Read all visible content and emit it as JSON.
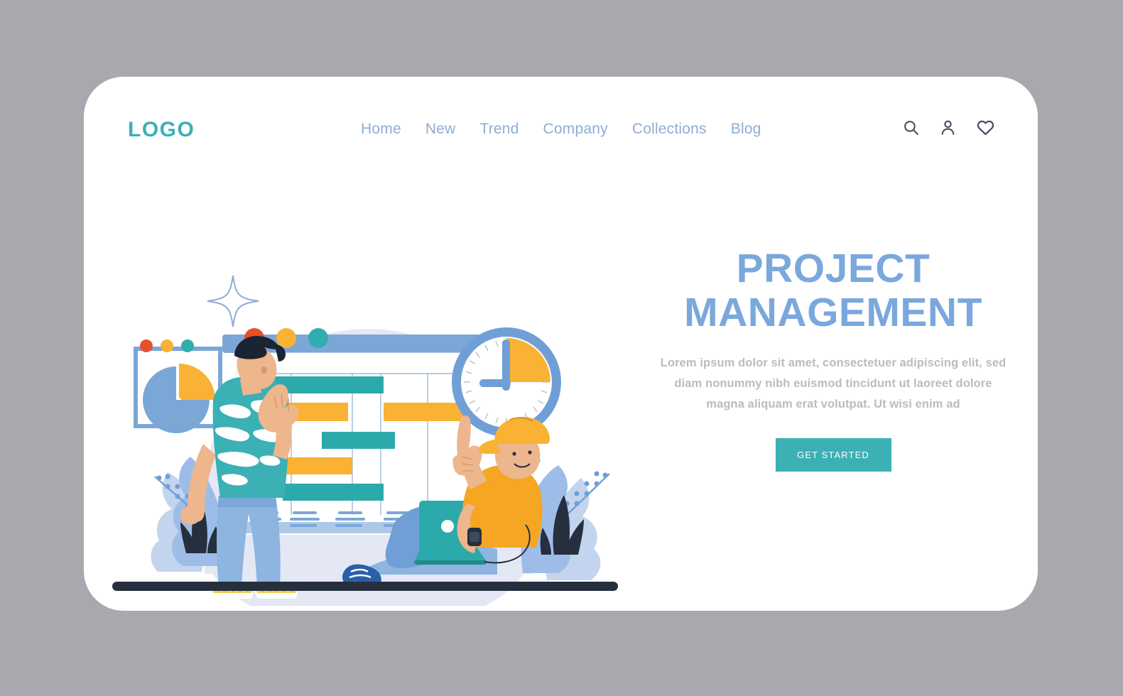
{
  "page": {
    "background_color": "#a9a8ae",
    "card_background": "#ffffff"
  },
  "header": {
    "logo": "LOGO",
    "logo_color": "#3bb0b5",
    "nav": [
      {
        "label": "Home"
      },
      {
        "label": "New"
      },
      {
        "label": "Trend"
      },
      {
        "label": "Company"
      },
      {
        "label": "Collections"
      },
      {
        "label": "Blog"
      }
    ],
    "nav_color": "#8eadd4",
    "actions": [
      {
        "icon": "search-icon"
      },
      {
        "icon": "user-icon"
      },
      {
        "icon": "heart-icon"
      }
    ],
    "action_color": "#454f63"
  },
  "hero": {
    "title_line_1": "PROJECT",
    "title_line_2": "MANAGEMENT",
    "title_color": "#7aa8dd",
    "paragraph": "Lorem ipsum dolor sit amet, consectetuer adipiscing elit, sed diam nonummy nibh euismod tincidunt ut laoreet dolore magna aliquam erat volutpat. Ut wisi enim ad",
    "paragraph_color": "#b9bcc2",
    "cta_label": "GET STARTED",
    "cta_background": "#3bb0b5",
    "cta_text_color": "#ffffff"
  },
  "illustration": {
    "name": "project-management-scene",
    "backdrop_circle_color": "#e4e8f5",
    "ground_line_color": "#262f3d",
    "window": {
      "title_bar_color": "#7ba7d7",
      "body_color": "#ffffff",
      "dots": [
        {
          "name": "dot-red",
          "color": "#e8502a"
        },
        {
          "name": "dot-yellow",
          "color": "#f9b233"
        },
        {
          "name": "dot-teal",
          "color": "#30adaf"
        }
      ]
    },
    "gantt": {
      "axis_color": "#8eadd4",
      "bar_colors": {
        "teal": "#2ca9ab",
        "orange": "#f9b233"
      },
      "bars": [
        {
          "label": "task-1",
          "color": "teal",
          "start": 0,
          "length": 0.6
        },
        {
          "label": "task-2",
          "color": "orange",
          "start": 0,
          "length": 0.42
        },
        {
          "label": "task-3",
          "color": "orange",
          "start": 0.62,
          "length": 0.33
        },
        {
          "label": "task-4",
          "color": "teal",
          "start": 0.31,
          "length": 0.33
        },
        {
          "label": "task-5",
          "color": "orange",
          "start": 0.11,
          "length": 0.31
        },
        {
          "label": "task-6",
          "color": "teal",
          "start": 0.11,
          "length": 0.5
        }
      ],
      "legend_groups": 5,
      "legend_line_color": "#7ba7d7"
    },
    "pie_panel": {
      "frame_color": "#7ba7d7",
      "slices": [
        {
          "name": "slice-blue",
          "color": "#7ba7d7",
          "percent": 72
        },
        {
          "name": "slice-orange",
          "color": "#f9b233",
          "percent": 28
        }
      ],
      "dots": [
        {
          "name": "dot-red",
          "color": "#e8502a"
        },
        {
          "name": "dot-yellow",
          "color": "#f9b233"
        },
        {
          "name": "dot-teal",
          "color": "#30adaf"
        }
      ]
    },
    "clock": {
      "ring_color": "#6f9fd6",
      "face_color": "#ffffff",
      "segment_color": "#f9b233",
      "hand_color": "#6f9fd6",
      "tick_color": "#bfc6d4"
    },
    "sparkles": [
      {
        "name": "sparkle-top",
        "color": "#8eadd4"
      },
      {
        "name": "sparkle-left",
        "color": "#8eadd4"
      },
      {
        "name": "sparkle-right",
        "color": "#8eadd4"
      }
    ],
    "plants": {
      "leaf_light": "#c3d4ef",
      "leaf_mid": "#9dbde8",
      "leaf_dark": "#262f3d",
      "stem_color": "#6f9fd6"
    },
    "person_standing": {
      "name": "person-standing-presenter",
      "hair_color": "#1b2433",
      "skin_color": "#edb68d",
      "shirt_color": "#3bb0b5",
      "shirt_pattern_color": "#ffffff",
      "pants_color": "#8eb4e0",
      "shoe_color": "#f6d24c"
    },
    "person_seated": {
      "name": "person-seated-laptop",
      "cap_color": "#f9b233",
      "skin_color": "#edb68d",
      "shirt_color": "#f5a623",
      "pants_color": "#8eb4e0",
      "laptop_color": "#2ca9ab",
      "shoe_color": "#2a5fa8",
      "watch_color": "#262f3d"
    }
  }
}
